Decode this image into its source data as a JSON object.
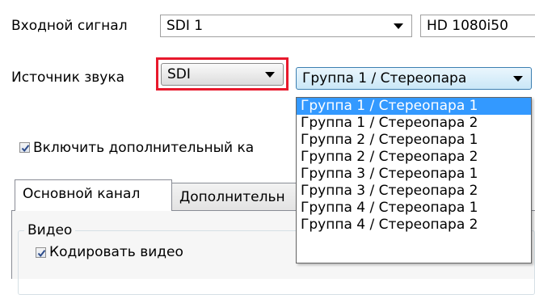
{
  "input_signal": {
    "label": "Входной сигнал",
    "source_value": "SDI 1",
    "format_value": "HD 1080i50"
  },
  "audio_source": {
    "label": "Источник звука",
    "source_value": "SDI",
    "group_value": "Группа 1 / Стереопара",
    "options": [
      "Группа 1 / Стереопара 1",
      "Группа 1 / Стереопара 2",
      "Группа 2 / Стереопара 1",
      "Группа 2 / Стереопара 2",
      "Группа 3 / Стереопара 1",
      "Группа 3 / Стереопара 2",
      "Группа 4 / Стереопара 1",
      "Группа 4 / Стереопара 2"
    ],
    "selected_index": 0
  },
  "extra_channel_checkbox": {
    "label": "Включить дополнительный ка",
    "checked": true
  },
  "tabs": [
    {
      "label": "Основной канал"
    },
    {
      "label": "Дополнительн"
    }
  ],
  "video_group": {
    "title": "Видео",
    "encode_checkbox": {
      "label": "Кодировать видео",
      "checked": true
    }
  },
  "colors": {
    "highlight": "#e8192c",
    "selection": "#3399ff",
    "check": "#2b4a8a"
  }
}
